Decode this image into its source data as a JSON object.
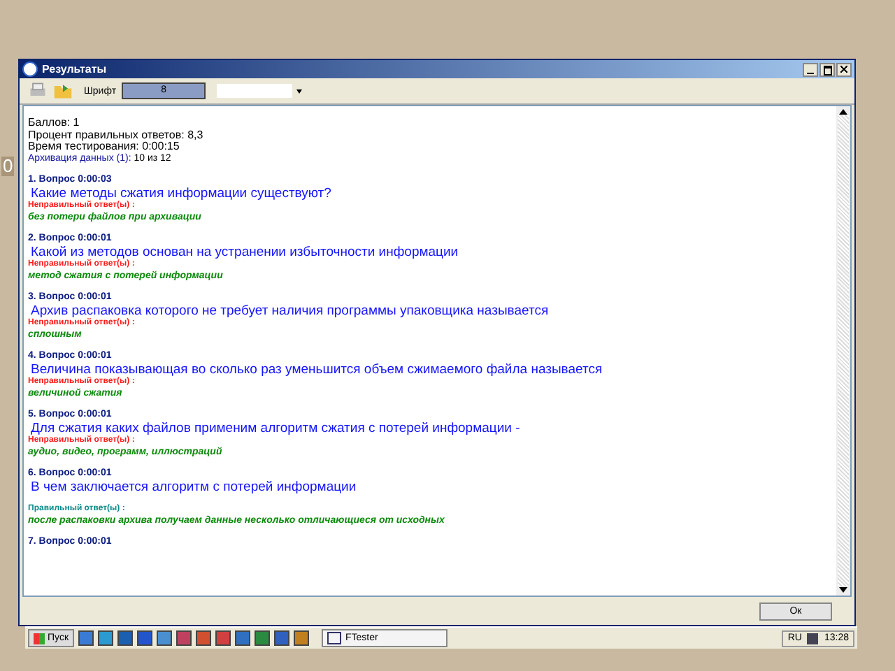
{
  "slide_mark": "0",
  "window": {
    "title": "Результаты"
  },
  "toolbar": {
    "font_label": "Шрифт",
    "font_size": "8"
  },
  "summary": [
    "Баллов: 1",
    "Процент правильных ответов: 8,3",
    "Время тестирования: 0:00:15"
  ],
  "topic": {
    "label": "Архивация данных (1):",
    "value": "10 из 12"
  },
  "questions": [
    {
      "header": "1. Вопрос 0:00:03",
      "text": "Какие методы сжатия информации существуют?",
      "kind": "incorrect",
      "verdict": "Неправильный ответ(ы) :",
      "answer": "без потери файлов при архивации"
    },
    {
      "header": "2. Вопрос 0:00:01",
      "text": "Какой из методов основан на устранении избыточности информации",
      "kind": "incorrect",
      "verdict": "Неправильный ответ(ы) :",
      "answer": "метод сжатия с потерей информации"
    },
    {
      "header": "3. Вопрос 0:00:01",
      "text": "Архив распаковка которого не требует наличия программы упаковщика называется",
      "kind": "incorrect",
      "verdict": "Неправильный ответ(ы) :",
      "answer": "сплошным"
    },
    {
      "header": "4. Вопрос 0:00:01",
      "text": "Величина показывающая во сколько раз уменьшится объем сжимаемого файла называется",
      "kind": "incorrect",
      "verdict": "Неправильный ответ(ы) :",
      "answer": "величиной сжатия"
    },
    {
      "header": "5. Вопрос 0:00:01",
      "text": "Для сжатия каких файлов применим алгоритм сжатия с потерей информации -",
      "kind": "incorrect",
      "verdict": "Неправильный ответ(ы) :",
      "answer": "аудио, видео, программ, иллюстраций"
    },
    {
      "header": "6. Вопрос 0:00:01",
      "text": "В чем заключается  алгоритм с потерей информации",
      "kind": "correct",
      "verdict": "Правильный ответ(ы) :",
      "answer": "после распаковки архива получаем данные несколько отличающиеся от исходных"
    },
    {
      "header": "7. Вопрос 0:00:01"
    }
  ],
  "ok_button": "Ок",
  "taskbar": {
    "start": "Пуск",
    "task": "FTester",
    "tray_lang": "RU",
    "clock": "13:28"
  }
}
